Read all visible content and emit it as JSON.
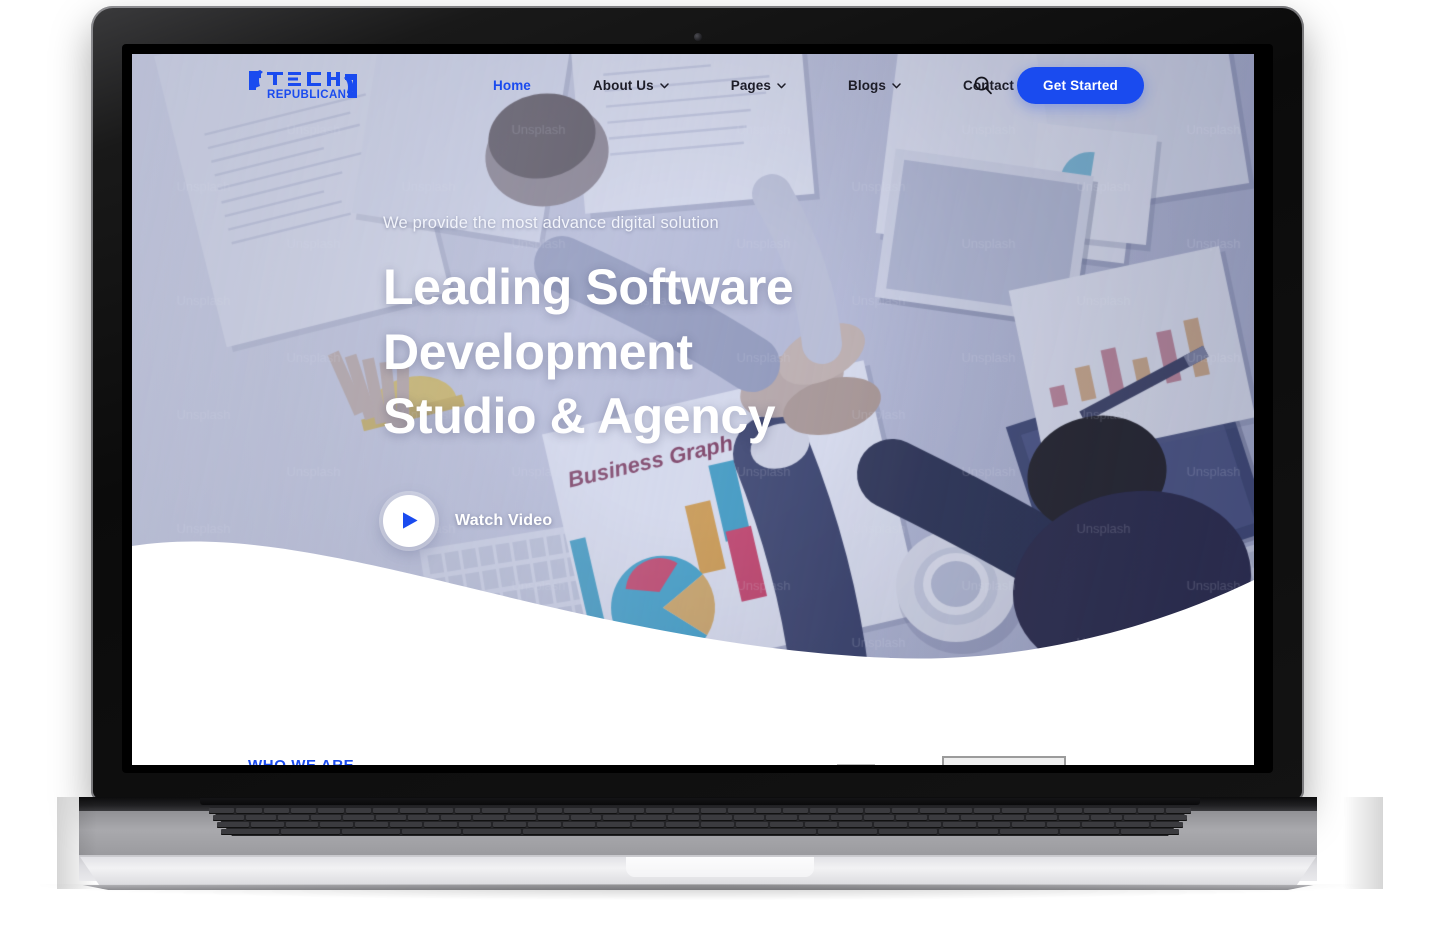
{
  "device": {
    "type": "laptop-mockup",
    "webcam": "webcam-dot"
  },
  "site": {
    "logo": {
      "primary_text": "TECH",
      "secondary_text": "REPUBLICANS",
      "color": "#1a4bef"
    },
    "nav": {
      "items": [
        {
          "label": "Home",
          "active": true,
          "has_dropdown": false
        },
        {
          "label": "About Us",
          "active": false,
          "has_dropdown": true
        },
        {
          "label": "Pages",
          "active": false,
          "has_dropdown": true
        },
        {
          "label": "Blogs",
          "active": false,
          "has_dropdown": true
        },
        {
          "label": "Contact",
          "active": false,
          "has_dropdown": false
        }
      ],
      "search_icon": "search-icon",
      "cta_label": "Get Started",
      "cta_color": "#1a4bef",
      "active_color": "#1a4bef",
      "link_color": "#1d1d28"
    },
    "hero": {
      "eyebrow": "We provide the most advance digital solution",
      "headline_line1": "Leading Software",
      "headline_line2": "Development",
      "headline_line3": "Studio & Agency",
      "headline_color": "#ffffff",
      "watch_label": "Watch Video",
      "play_icon": "play-icon",
      "background": "office-desk-teamwork-photo"
    },
    "below_fold": {
      "section_label": "WHO WE ARE",
      "section_label_color": "#1a4bef"
    }
  }
}
